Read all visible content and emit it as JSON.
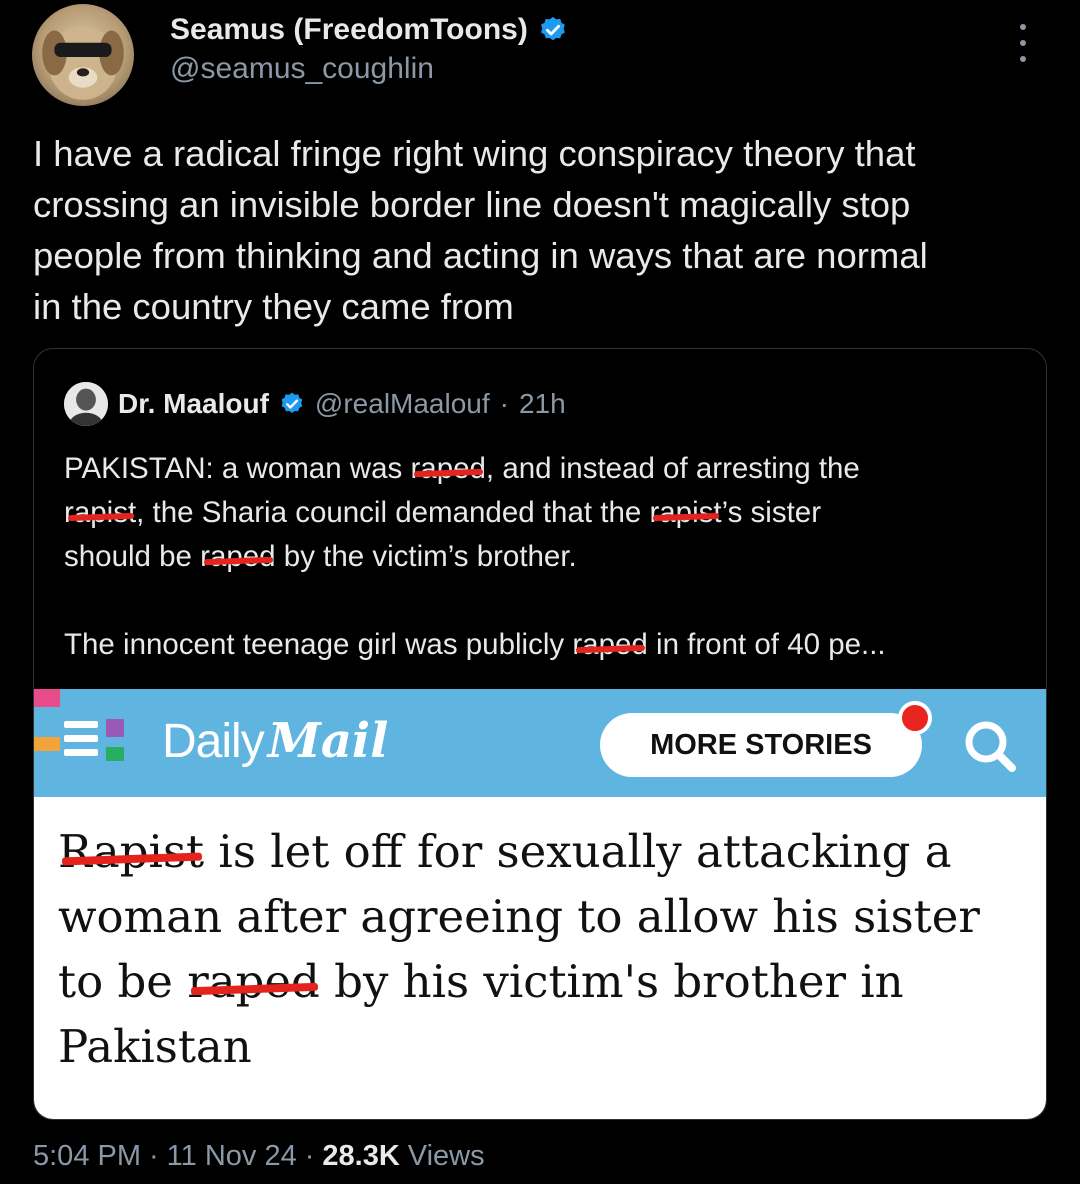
{
  "author": {
    "display_name": "Seamus (FreedomToons)",
    "handle": "@seamus_coughlin",
    "verified_icon": "verified-badge-icon",
    "avatar": "dog-with-sunglasses"
  },
  "tweet": {
    "text": "I have a radical fringe right wing conspiracy theory that\ncrossing an invisible border line doesn't magically stop\npeople from thinking and acting in ways that are normal\nin the country they came from"
  },
  "quoted": {
    "display_name": "Dr. Maalouf",
    "handle": "@realMaalouf",
    "separator": "·",
    "time": "21h",
    "p1": {
      "a": "PAKISTAN: a woman was ",
      "r1": "raped",
      "b": ", and instead of arresting the",
      "r2": "rapist",
      "c": ", the Sharia council demanded that the ",
      "r3": "rapist",
      "d": "’s sister",
      "e": "should be ",
      "r4": "raped",
      "f": " by the victim’s brother."
    },
    "p2": {
      "a": "The innocent teenage girl was publicly ",
      "r1": "raped",
      "b": " in front of 40 pe..."
    }
  },
  "article": {
    "brand_daily": "Daily",
    "brand_mail": "Mail",
    "more_stories": "MORE STORIES",
    "headline": {
      "r1": "Rapist",
      "a": " is let off for sexually attacking a woman after agreeing to allow his sister to be ",
      "r2": "raped",
      "b": " by his victim's brother in Pakistan"
    },
    "bar_color": "#5fb4e0"
  },
  "footer": {
    "time": "5:04 PM",
    "sep1": "·",
    "date": "11 Nov 24",
    "sep2": "·",
    "views_count": "28.3K",
    "views_label": "Views"
  },
  "colors": {
    "background": "#000000",
    "text": "#e7e9ea",
    "muted": "#8b98a5",
    "verified": "#1d9bf0",
    "redaction": "#e3231c"
  }
}
